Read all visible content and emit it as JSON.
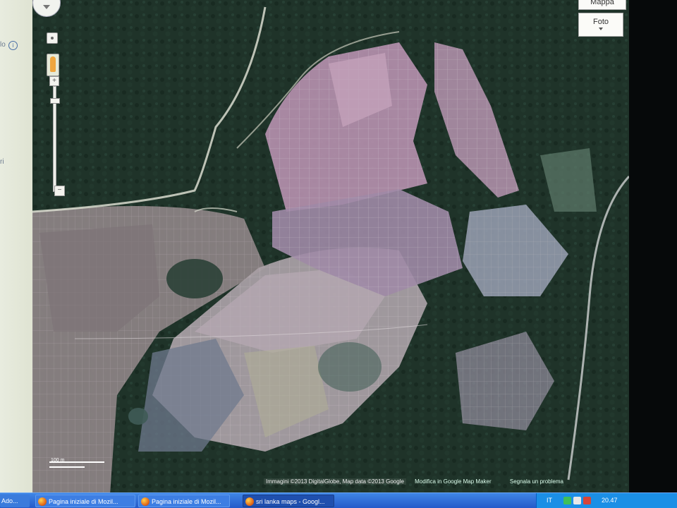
{
  "sidebar": {
    "text_top": "lo",
    "text_mid": "ri"
  },
  "map": {
    "map_button_label": "Mappa",
    "photo_button_label": "Foto",
    "scale_label": "100 m",
    "footer": {
      "imagery": "Immagini ©2013 DigitalGlobe, Map data ©2013 Google",
      "edit_link": "Modifica in Google Map Maker",
      "report_link": "Segnala un problema"
    }
  },
  "taskbar": {
    "items": [
      {
        "label": "Ado..."
      },
      {
        "label": "Pagina iniziale di Mozil..."
      },
      {
        "label": "Pagina iniziale di Mozil..."
      },
      {
        "label": "sri lanka maps - Googl..."
      }
    ],
    "language": "IT",
    "clock": "20.47"
  },
  "colors": {
    "taskbar_blue": "#2f6fd8",
    "tray_blue": "#1b8fe6",
    "forest": "#1e3128",
    "fields_pink": "#b8a0b2"
  },
  "icons": [
    "info-icon",
    "pan-control-icon",
    "pegman-icon",
    "zoom-in-icon",
    "zoom-out-icon",
    "firefox-icon",
    "tray-icon"
  ]
}
